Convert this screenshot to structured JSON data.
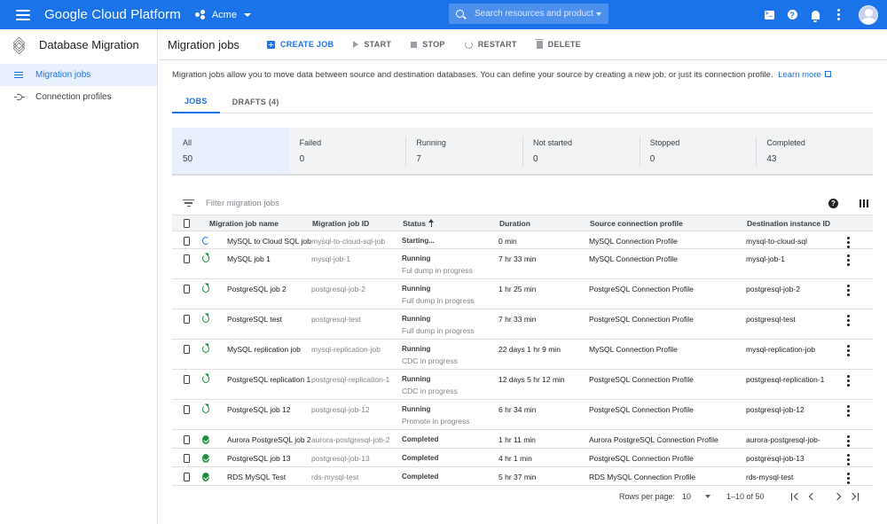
{
  "topbar": {
    "brand": "Google Cloud Platform",
    "project": "Acme",
    "search_placeholder": "Search resources and product",
    "icons": [
      "menu-icon",
      "project-icon",
      "search-icon",
      "cloud-shell-icon",
      "help-icon",
      "notifications-icon",
      "more-vert-icon",
      "avatar"
    ],
    "color": "#1a73e8"
  },
  "sidebar": {
    "title": "Database Migration",
    "items": [
      {
        "label": "Migration jobs",
        "icon": "list-icon",
        "active": true
      },
      {
        "label": "Connection profiles",
        "icon": "connection-icon",
        "active": false
      }
    ]
  },
  "header": {
    "title": "Migration jobs",
    "actions": {
      "create": "CREATE JOB",
      "start": "START",
      "stop": "STOP",
      "restart": "RESTART",
      "delete": "DELETE"
    }
  },
  "intro": {
    "text": "Migration jobs allow you to move data between source and destination databases. You can define your source by creating a new job, or just its connection profile.",
    "link": "Learn more"
  },
  "tabs": [
    {
      "label": "JOBS",
      "active": true
    },
    {
      "label": "DRAFTS (4)",
      "active": false
    }
  ],
  "stats": [
    {
      "label": "All",
      "count": "50",
      "active": true
    },
    {
      "label": "Failed",
      "count": "0"
    },
    {
      "label": "Running",
      "count": "7"
    },
    {
      "label": "Not started",
      "count": "0"
    },
    {
      "label": "Stopped",
      "count": "0"
    },
    {
      "label": "Completed",
      "count": "43"
    }
  ],
  "filter": {
    "placeholder": "Filter migration jobs"
  },
  "table": {
    "columns": {
      "name": "Migration job name",
      "id": "Migration job ID",
      "status": "Status",
      "duration": "Duration",
      "source": "Source connection profile",
      "destination": "Destination instance ID"
    },
    "rows": [
      {
        "name": "MySQL to Cloud SQL job",
        "id": "mysql-to-cloud-sql-job",
        "status": "Starting...",
        "sub": "",
        "state": "starting",
        "duration": "0 min",
        "source": "MySQL Connection Profile",
        "destination": "mysql-to-cloud-sql"
      },
      {
        "name": "MySQL job 1",
        "id": "mysql-job-1",
        "status": "Running",
        "sub": "Ful dump in progress",
        "state": "running",
        "duration": "7 hr 33 min",
        "source": "MySQL Connection Profile",
        "destination": "mysql-job-1"
      },
      {
        "name": "PostgreSQL job 2",
        "id": "postgresql-job-2",
        "status": "Running",
        "sub": "Full dump in progress",
        "state": "running",
        "duration": "1 hr 25 min",
        "source": "PostgreSQL Connection Profile",
        "destination": "postgresql-job-2"
      },
      {
        "name": "PostgreSQL test",
        "id": "postgresql-test",
        "status": "Running",
        "sub": "Full dump in progress",
        "state": "running",
        "duration": "7 hr 33 min",
        "source": "PostgreSQL Connection Profile",
        "destination": "postgresql-test"
      },
      {
        "name": "MySQL replication job",
        "id": "mysql-replication-job",
        "status": "Running",
        "sub": "CDC in progress",
        "state": "running",
        "duration": "22 days 1 hr 9 min",
        "source": "MySQL Connection Profile",
        "destination": "mysql-replication-job"
      },
      {
        "name": "PostgreSQL replication 1",
        "id": "postgresql-replication-1",
        "status": "Running",
        "sub": "CDC in progress",
        "state": "running",
        "duration": "12 days 5 hr 12 min",
        "source": "PostgreSQL Connection Profile",
        "destination": "postgresql-replication-1"
      },
      {
        "name": "PostgreSQL job 12",
        "id": "postgresql-job-12",
        "status": "Running",
        "sub": "Promote in progress",
        "state": "running",
        "duration": "6 hr 34 min",
        "source": "PostgreSQL Connection Profile",
        "destination": "postgresql-job-12"
      },
      {
        "name": "Aurora PostgreSQL job 2",
        "id": "aurora-postgresql-job-2",
        "status": "Completed",
        "sub": "",
        "state": "completed",
        "duration": "1 hr 11 min",
        "source": "Aurora PostgreSQL Connection Profile",
        "destination": "aurora-postgresql-job-"
      },
      {
        "name": "PostgreSQL job 13",
        "id": "postgresql-job-13",
        "status": "Completed",
        "sub": "",
        "state": "completed",
        "duration": "4 hr 1 min",
        "source": "PostgreSQL Connection Profile",
        "destination": "postgresql-job-13"
      },
      {
        "name": "RDS MySQL Test",
        "id": "rds-mysql-test",
        "status": "Completed",
        "sub": "",
        "state": "completed",
        "duration": "5 hr 37 min",
        "source": "RDS MySQL Connection Profile",
        "destination": "rds-mysql-test"
      }
    ]
  },
  "pagination": {
    "rows_label": "Rows per page:",
    "rows_value": "10",
    "range": "1–10 of 50"
  }
}
